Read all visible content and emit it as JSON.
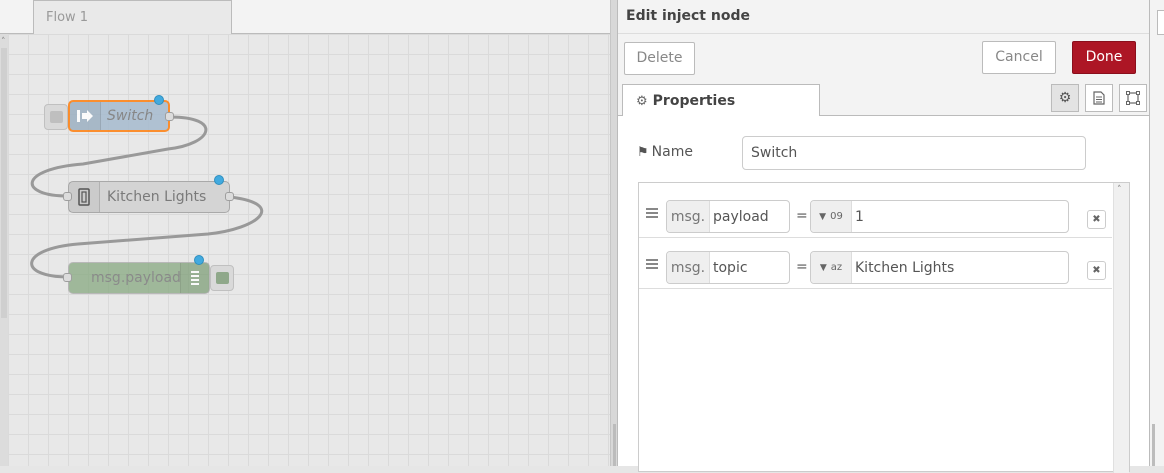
{
  "workspace": {
    "flow_tab": "Flow 1",
    "nodes": [
      {
        "label": "Switch",
        "type": "inject"
      },
      {
        "label": "Kitchen Lights",
        "type": "switch"
      },
      {
        "label": "msg.payload",
        "type": "debug"
      }
    ]
  },
  "editor": {
    "title": "Edit inject node",
    "delete_label": "Delete",
    "cancel_label": "Cancel",
    "done_label": "Done",
    "properties_tab": "Properties",
    "icon_tabs": [
      "gear-icon",
      "description-icon",
      "appearance-icon"
    ],
    "name_label": "Name",
    "name_value": "Switch",
    "rows": [
      {
        "prefix": "msg.",
        "property": "payload",
        "equals": "=",
        "type_icon": "number-type-icon",
        "type_glyph": "09",
        "value": "1"
      },
      {
        "prefix": "msg.",
        "property": "topic",
        "equals": "=",
        "type_icon": "string-type-icon",
        "type_glyph": "az",
        "value": "Kitchen Lights"
      }
    ]
  },
  "colors": {
    "done_button": "#ad1625",
    "status_dot": "#42aadf",
    "inject_node": "#a6bbcf",
    "debug_node": "#87a980",
    "selected_outline": "#ff7f0e"
  }
}
